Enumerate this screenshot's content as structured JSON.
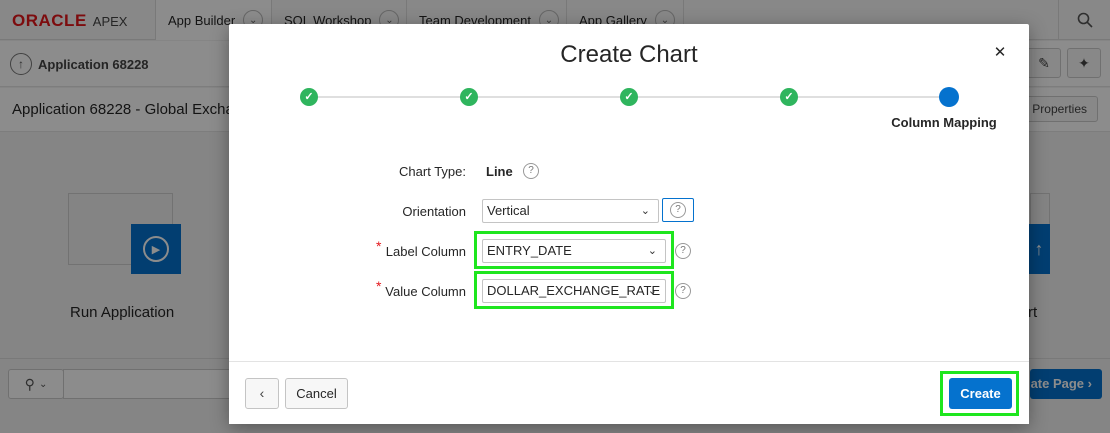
{
  "brand": {
    "oracle": "ORACLE",
    "apex": "APEX",
    "oracle_color": "#e3161b"
  },
  "nav_tabs": [
    {
      "label": "App Builder"
    },
    {
      "label": "SQL Workshop"
    },
    {
      "label": "Team Development"
    },
    {
      "label": "App Gallery"
    }
  ],
  "breadcrumb": {
    "label": "Application 68228"
  },
  "page_title": "Application 68228 - Global Excha",
  "props_button": "n Properties",
  "tiles": {
    "run_label": "Run Application",
    "right_label": "rt"
  },
  "bottom": {
    "create_page": "ate Page"
  },
  "dialog": {
    "title": "Create Chart",
    "close_icon": "close-icon",
    "steps": [
      {
        "state": "complete"
      },
      {
        "state": "complete"
      },
      {
        "state": "complete"
      },
      {
        "state": "complete"
      },
      {
        "state": "current",
        "label": "Column Mapping"
      }
    ],
    "fields": {
      "chart_type": {
        "label": "Chart Type:",
        "value": "Line"
      },
      "orientation": {
        "label": "Orientation",
        "value": "Vertical"
      },
      "label_column": {
        "label": "Label Column",
        "value": "ENTRY_DATE",
        "required": true
      },
      "value_column": {
        "label": "Value Column",
        "value": "DOLLAR_EXCHANGE_RATE",
        "required": true
      }
    },
    "help_glyph": "?",
    "footer": {
      "cancel": "Cancel",
      "create": "Create"
    }
  },
  "colors": {
    "accent": "#0572ce",
    "success": "#2fb55e",
    "highlight": "#1ee61e"
  }
}
